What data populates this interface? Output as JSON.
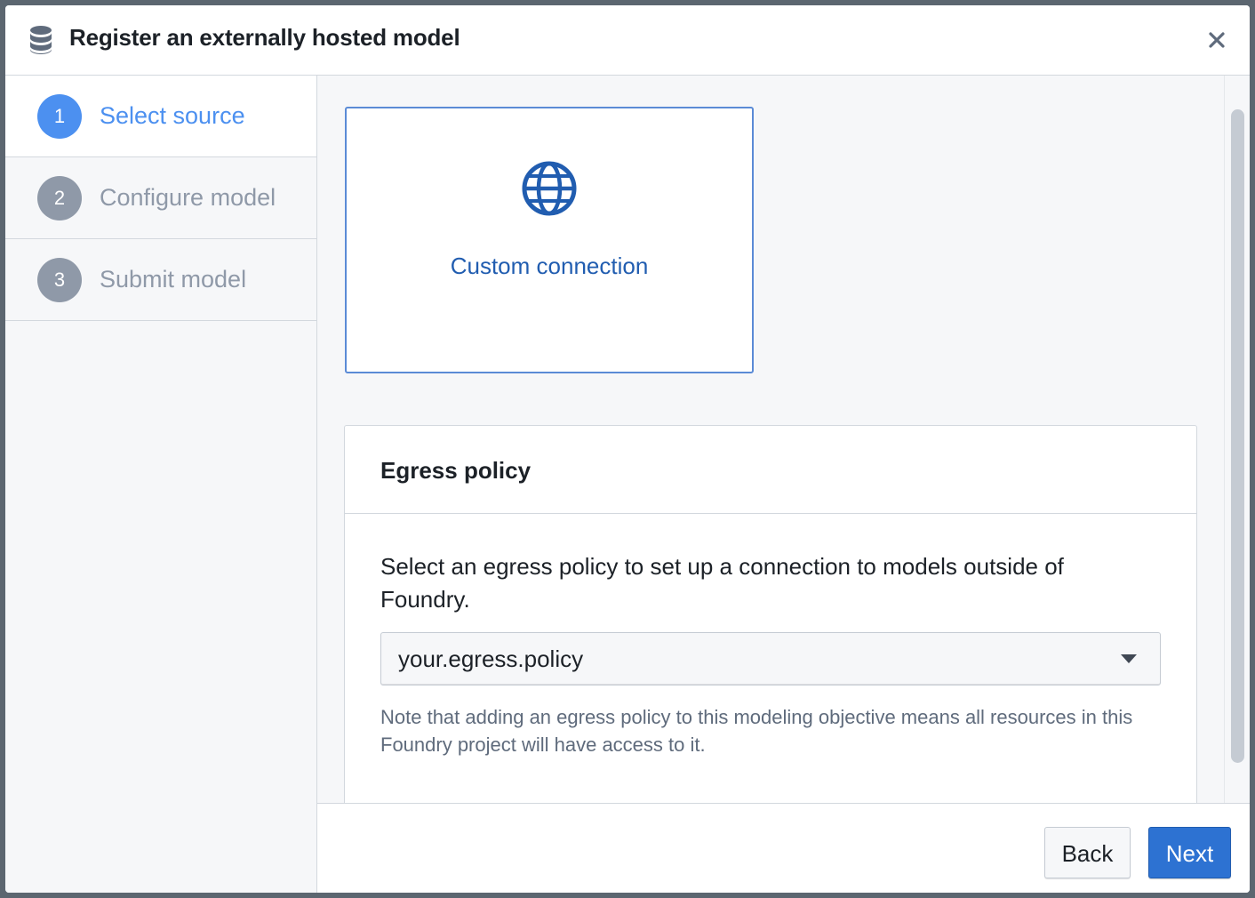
{
  "dialog": {
    "title": "Register an externally hosted model",
    "header_icon": "database-icon",
    "close_icon": "close-icon"
  },
  "steps": [
    {
      "number": "1",
      "label": "Select source",
      "active": true
    },
    {
      "number": "2",
      "label": "Configure model",
      "active": false
    },
    {
      "number": "3",
      "label": "Submit model",
      "active": false
    }
  ],
  "source": {
    "icon": "globe-icon",
    "label": "Custom connection"
  },
  "egress": {
    "title": "Egress policy",
    "description": "Select an egress policy to set up a connection to models outside of Foundry.",
    "selected_value": "your.egress.policy",
    "note": "Note that adding an egress policy to this modeling objective means all resources in this Foundry project will have access to it."
  },
  "footer": {
    "back_label": "Back",
    "next_label": "Next"
  },
  "colors": {
    "accent": "#2d72d2",
    "active_step": "#4c90f0",
    "inactive_step": "#8f99a8",
    "link_text": "#215db0"
  }
}
